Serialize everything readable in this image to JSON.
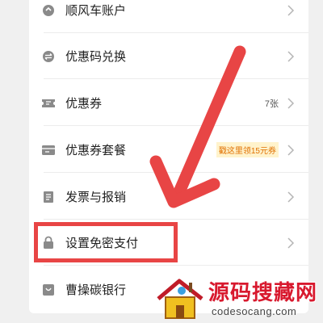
{
  "menu": {
    "items": [
      {
        "label": "顺风车账户",
        "icon": "wallet-icon",
        "extra": "",
        "badge": ""
      },
      {
        "label": "优惠码兑换",
        "icon": "exchange-icon",
        "extra": "",
        "badge": ""
      },
      {
        "label": "优惠券",
        "icon": "ticket-icon",
        "extra": "7张",
        "badge": ""
      },
      {
        "label": "优惠券套餐",
        "icon": "coupon-package-icon",
        "extra": "",
        "badge": "戳这里领15元券"
      },
      {
        "label": "发票与报销",
        "icon": "invoice-icon",
        "extra": "",
        "badge": ""
      },
      {
        "label": "设置免密支付",
        "icon": "lock-icon",
        "extra": "",
        "badge": ""
      },
      {
        "label": "曹操碳银行",
        "icon": "carbon-bank-icon",
        "extra": "",
        "badge": ""
      }
    ]
  },
  "annotation": {
    "arrow_color": "#e84545",
    "box_color": "#e84545"
  },
  "watermark": {
    "title": "源码搜藏网",
    "url": "codesocang.com"
  },
  "colors": {
    "icon": "#8a8a8a",
    "chevron": "#b5b5b5",
    "badge_text": "#e07000",
    "badge_bg": "#fff3cc"
  }
}
